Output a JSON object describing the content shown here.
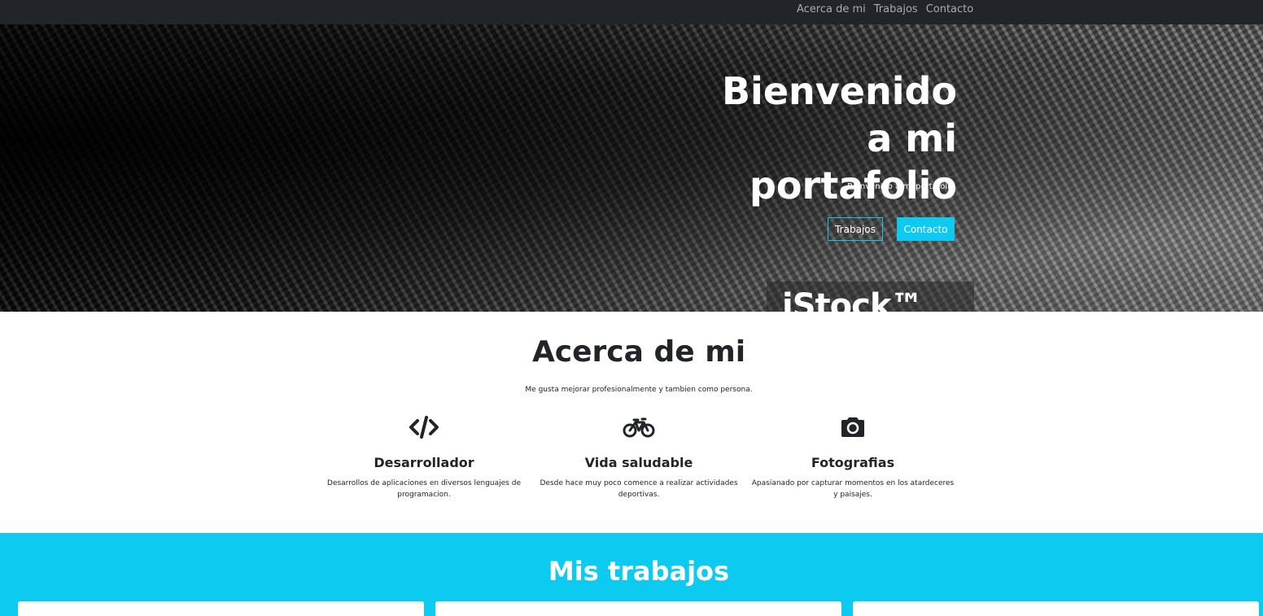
{
  "navbar": {
    "links": [
      "Acerca de mi",
      "Trabajos",
      "Contacto"
    ]
  },
  "hero": {
    "title": "Bienvenido a mi portafolio",
    "subtitle": "Bienvenido a mi portafolio",
    "button_works": "Trabajos",
    "button_contact": "Contacto",
    "watermark": "iStock™"
  },
  "about": {
    "title": "Acerca de mi",
    "subtitle": "Me gusta mejorar profesionalmente y tambien como persona.",
    "features": [
      {
        "icon": "code-icon",
        "title": "Desarrollador",
        "text": "Desarrollos de aplicaciones en diversos lenguajes de programacion."
      },
      {
        "icon": "bicycle-icon",
        "title": "Vida saludable",
        "text": "Desde hace muy poco comence a realizar actividades deportivas."
      },
      {
        "icon": "camera-icon",
        "title": "Fotografias",
        "text": "Apasianado por capturar momentos en los atardeceres y paisajes."
      }
    ]
  },
  "works": {
    "title": "Mis trabajos"
  },
  "colors": {
    "navbar": "#212529",
    "accent": "#0dcaf0",
    "text": "#212529"
  }
}
